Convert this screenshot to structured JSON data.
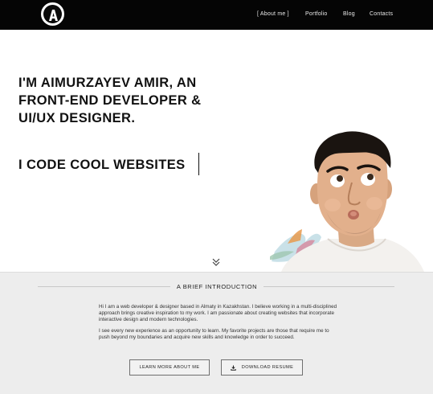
{
  "nav": {
    "logo_letter": "A",
    "links": [
      {
        "label": "[ About me ]"
      },
      {
        "label": "Portfolio"
      },
      {
        "label": "Blog"
      },
      {
        "label": "Contacts"
      }
    ]
  },
  "hero": {
    "headline_lines": [
      "I'M AIMURZAYEV AMIR, AN",
      "FRONT-END DEVELOPER &",
      "UI/UX DESIGNER."
    ],
    "tagline": "I CODE COOL WEBSITES"
  },
  "intro": {
    "title": "A BRIEF INTRODUCTION",
    "paragraphs": [
      "Hi I am a web developer & designer based in Almaty in Kazakhstan. I believe working in a multi-disciplined approach brings creative inspiration to my work. I am passionate about creating websites that incorporate interactive design and modern technologies.",
      "I see every new experience as an opportunity to learn. My favorite projects are those that require me to push beyond my boundaries and acquire new skills and knowledge in order to succeed."
    ],
    "buttons": {
      "learn_more": "LEARN MORE ABOUT ME",
      "download": "DOWNLOAD RESUME"
    }
  },
  "colors": {
    "nav_bg": "#050505",
    "intro_bg": "#ededed",
    "text": "#111111"
  },
  "icons": {
    "logo": "circle-letter-a-logo",
    "scroll": "double-chevron-down-icon",
    "download": "download-icon"
  }
}
